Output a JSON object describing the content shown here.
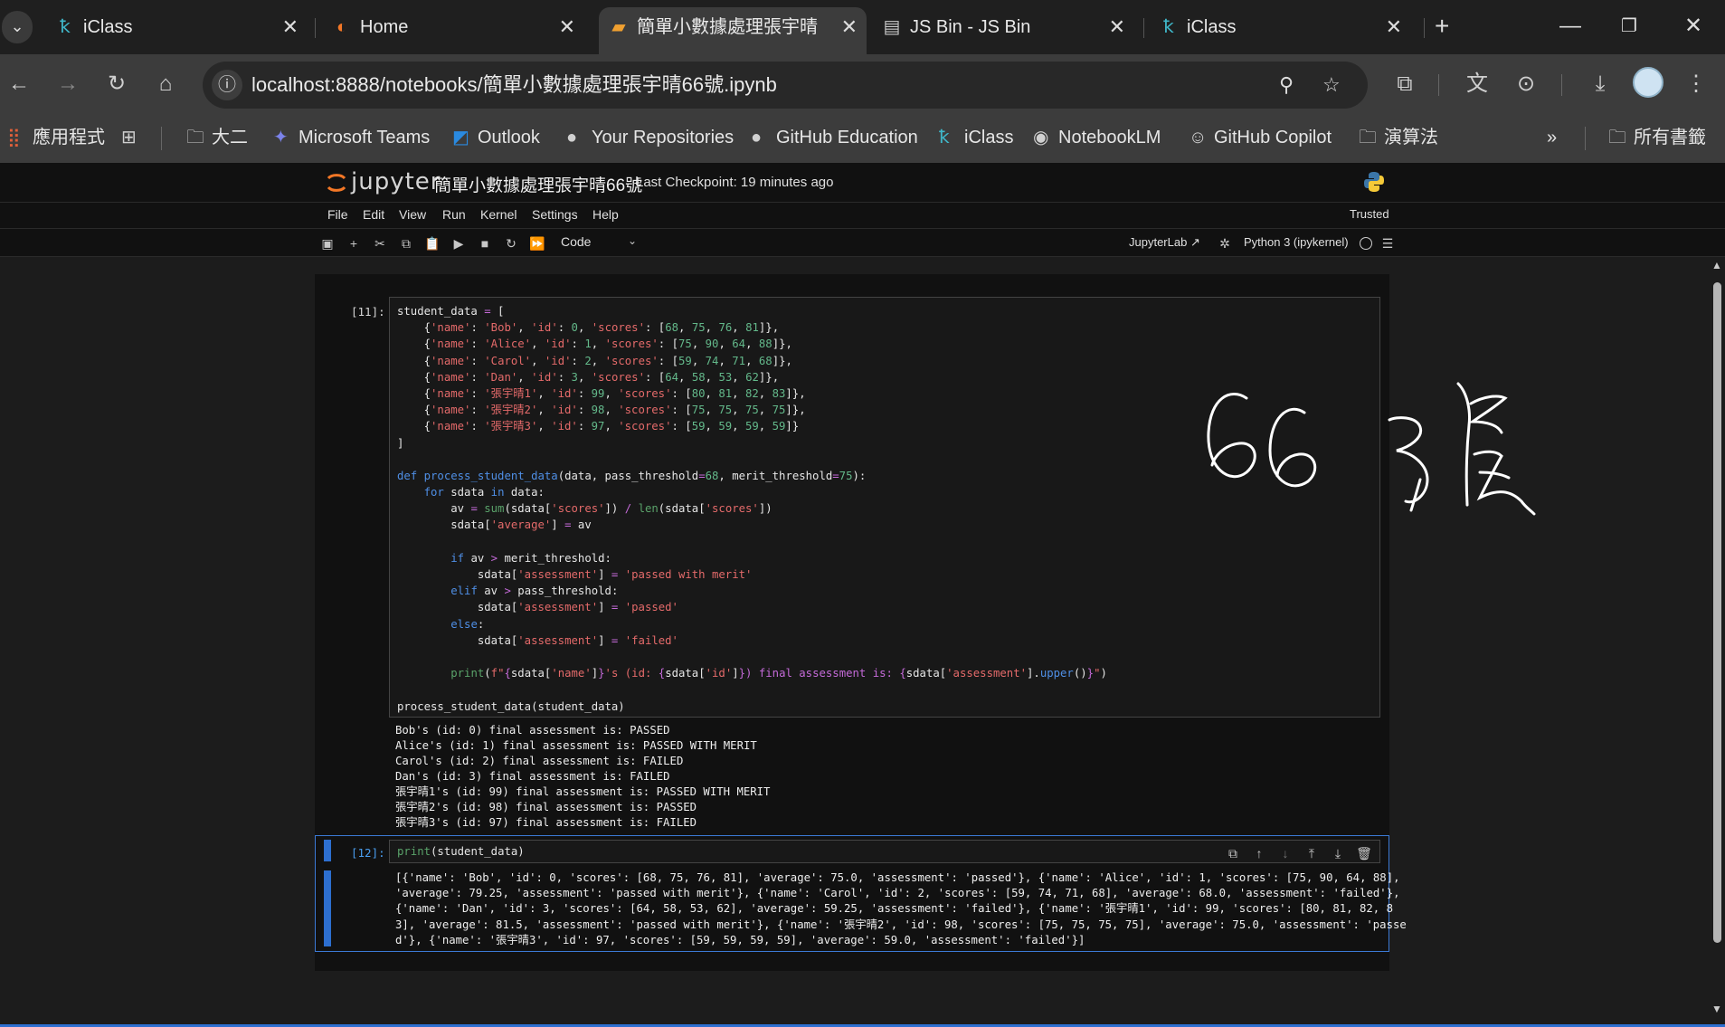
{
  "browser": {
    "tabs": [
      {
        "title": "iClass",
        "icon": "iclass-icon",
        "active": false
      },
      {
        "title": "Home",
        "icon": "jupyter-icon",
        "active": false
      },
      {
        "title": "簡單小數據處理張宇晴66",
        "icon": "notebook-icon",
        "active": true
      },
      {
        "title": "JS Bin - JS Bin",
        "icon": "jsbin-icon",
        "active": false
      },
      {
        "title": "iClass",
        "icon": "iclass-icon",
        "active": false
      }
    ],
    "close_glyph": "✕",
    "new_tab_glyph": "+",
    "url": "localhost:8888/notebooks/簡單小數據處理張宇晴66號.ipynb",
    "bookmarks": [
      {
        "label": "應用程式",
        "icon": "apps-grid-icon"
      },
      {
        "label": "",
        "icon": "grid-icon"
      },
      {
        "label": "大二",
        "icon": "folder-icon"
      },
      {
        "label": "Microsoft Teams",
        "icon": "teams-icon"
      },
      {
        "label": "Outlook",
        "icon": "outlook-icon"
      },
      {
        "label": "Your Repositories",
        "icon": "github-icon"
      },
      {
        "label": "GitHub Education",
        "icon": "github-icon"
      },
      {
        "label": "iClass",
        "icon": "iclass-icon"
      },
      {
        "label": "NotebookLM",
        "icon": "notebooklm-icon"
      },
      {
        "label": "GitHub Copilot",
        "icon": "copilot-icon"
      },
      {
        "label": "演算法",
        "icon": "folder-icon"
      },
      {
        "label": "所有書籤",
        "icon": "folder-icon"
      }
    ],
    "bookmarks_overflow": "»"
  },
  "jupyter": {
    "logo_text": "jupyter",
    "notebook_title": "簡單小數據處理張宇晴66號",
    "checkpoint": "Last Checkpoint: 19 minutes ago",
    "menu": [
      "File",
      "Edit",
      "View",
      "Run",
      "Kernel",
      "Settings",
      "Help"
    ],
    "trusted": "Trusted",
    "cell_type": "Code",
    "jupyterlab_link": "JupyterLab",
    "kernel_name": "Python 3 (ipykernel)"
  },
  "cells": [
    {
      "prompt": "[11]:",
      "code": [
        [
          [
            "student_data ",
            ""
          ],
          [
            "=",
            "op"
          ],
          [
            " [",
            ""
          ]
        ],
        [
          [
            "    {",
            ""
          ],
          [
            "'name'",
            "str"
          ],
          [
            ": ",
            ""
          ],
          [
            "'Bob'",
            "str"
          ],
          [
            ", ",
            ""
          ],
          [
            "'id'",
            "str"
          ],
          [
            ": ",
            ""
          ],
          [
            "0",
            "num"
          ],
          [
            ", ",
            ""
          ],
          [
            "'scores'",
            "str"
          ],
          [
            ": [",
            ""
          ],
          [
            "68",
            "num"
          ],
          [
            ", ",
            ""
          ],
          [
            "75",
            "num"
          ],
          [
            ", ",
            ""
          ],
          [
            "76",
            "num"
          ],
          [
            ", ",
            ""
          ],
          [
            "81",
            "num"
          ],
          [
            "]},",
            ""
          ]
        ],
        [
          [
            "    {",
            ""
          ],
          [
            "'name'",
            "str"
          ],
          [
            ": ",
            ""
          ],
          [
            "'Alice'",
            "str"
          ],
          [
            ", ",
            ""
          ],
          [
            "'id'",
            "str"
          ],
          [
            ": ",
            ""
          ],
          [
            "1",
            "num"
          ],
          [
            ", ",
            ""
          ],
          [
            "'scores'",
            "str"
          ],
          [
            ": [",
            ""
          ],
          [
            "75",
            "num"
          ],
          [
            ", ",
            ""
          ],
          [
            "90",
            "num"
          ],
          [
            ", ",
            ""
          ],
          [
            "64",
            "num"
          ],
          [
            ", ",
            ""
          ],
          [
            "88",
            "num"
          ],
          [
            "]},",
            ""
          ]
        ],
        [
          [
            "    {",
            ""
          ],
          [
            "'name'",
            "str"
          ],
          [
            ": ",
            ""
          ],
          [
            "'Carol'",
            "str"
          ],
          [
            ", ",
            ""
          ],
          [
            "'id'",
            "str"
          ],
          [
            ": ",
            ""
          ],
          [
            "2",
            "num"
          ],
          [
            ", ",
            ""
          ],
          [
            "'scores'",
            "str"
          ],
          [
            ": [",
            ""
          ],
          [
            "59",
            "num"
          ],
          [
            ", ",
            ""
          ],
          [
            "74",
            "num"
          ],
          [
            ", ",
            ""
          ],
          [
            "71",
            "num"
          ],
          [
            ", ",
            ""
          ],
          [
            "68",
            "num"
          ],
          [
            "]},",
            ""
          ]
        ],
        [
          [
            "    {",
            ""
          ],
          [
            "'name'",
            "str"
          ],
          [
            ": ",
            ""
          ],
          [
            "'Dan'",
            "str"
          ],
          [
            ", ",
            ""
          ],
          [
            "'id'",
            "str"
          ],
          [
            ": ",
            ""
          ],
          [
            "3",
            "num"
          ],
          [
            ", ",
            ""
          ],
          [
            "'scores'",
            "str"
          ],
          [
            ": [",
            ""
          ],
          [
            "64",
            "num"
          ],
          [
            ", ",
            ""
          ],
          [
            "58",
            "num"
          ],
          [
            ", ",
            ""
          ],
          [
            "53",
            "num"
          ],
          [
            ", ",
            ""
          ],
          [
            "62",
            "num"
          ],
          [
            "]},",
            ""
          ]
        ],
        [
          [
            "    {",
            ""
          ],
          [
            "'name'",
            "str"
          ],
          [
            ": ",
            ""
          ],
          [
            "'張宇晴1'",
            "str"
          ],
          [
            ", ",
            ""
          ],
          [
            "'id'",
            "str"
          ],
          [
            ": ",
            ""
          ],
          [
            "99",
            "num"
          ],
          [
            ", ",
            ""
          ],
          [
            "'scores'",
            "str"
          ],
          [
            ": [",
            ""
          ],
          [
            "80",
            "num"
          ],
          [
            ", ",
            ""
          ],
          [
            "81",
            "num"
          ],
          [
            ", ",
            ""
          ],
          [
            "82",
            "num"
          ],
          [
            ", ",
            ""
          ],
          [
            "83",
            "num"
          ],
          [
            "]},",
            ""
          ]
        ],
        [
          [
            "    {",
            ""
          ],
          [
            "'name'",
            "str"
          ],
          [
            ": ",
            ""
          ],
          [
            "'張宇晴2'",
            "str"
          ],
          [
            ", ",
            ""
          ],
          [
            "'id'",
            "str"
          ],
          [
            ": ",
            ""
          ],
          [
            "98",
            "num"
          ],
          [
            ", ",
            ""
          ],
          [
            "'scores'",
            "str"
          ],
          [
            ": [",
            ""
          ],
          [
            "75",
            "num"
          ],
          [
            ", ",
            ""
          ],
          [
            "75",
            "num"
          ],
          [
            ", ",
            ""
          ],
          [
            "75",
            "num"
          ],
          [
            ", ",
            ""
          ],
          [
            "75",
            "num"
          ],
          [
            "]},",
            ""
          ]
        ],
        [
          [
            "    {",
            ""
          ],
          [
            "'name'",
            "str"
          ],
          [
            ": ",
            ""
          ],
          [
            "'張宇晴3'",
            "str"
          ],
          [
            ", ",
            ""
          ],
          [
            "'id'",
            "str"
          ],
          [
            ": ",
            ""
          ],
          [
            "97",
            "num"
          ],
          [
            ", ",
            ""
          ],
          [
            "'scores'",
            "str"
          ],
          [
            ": [",
            ""
          ],
          [
            "59",
            "num"
          ],
          [
            ", ",
            ""
          ],
          [
            "59",
            "num"
          ],
          [
            ", ",
            ""
          ],
          [
            "59",
            "num"
          ],
          [
            ", ",
            ""
          ],
          [
            "59",
            "num"
          ],
          [
            "]}",
            ""
          ]
        ],
        [
          [
            "]",
            ""
          ]
        ],
        [
          [
            "",
            ""
          ]
        ],
        [
          [
            "def",
            "kw"
          ],
          [
            " ",
            ""
          ],
          [
            "process_student_data",
            "fn"
          ],
          [
            "(data, pass_threshold",
            ""
          ],
          [
            "=",
            "op"
          ],
          [
            "68",
            "num"
          ],
          [
            ", merit_threshold",
            ""
          ],
          [
            "=",
            "op"
          ],
          [
            "75",
            "num"
          ],
          [
            "):",
            ""
          ]
        ],
        [
          [
            "    ",
            ""
          ],
          [
            "for",
            "kw"
          ],
          [
            " sdata ",
            ""
          ],
          [
            "in",
            "kw"
          ],
          [
            " data:",
            ""
          ]
        ],
        [
          [
            "        av ",
            ""
          ],
          [
            "=",
            "op"
          ],
          [
            " ",
            ""
          ],
          [
            "sum",
            "bi"
          ],
          [
            "(sdata[",
            ""
          ],
          [
            "'scores'",
            "str"
          ],
          [
            "]) ",
            ""
          ],
          [
            "/",
            "op"
          ],
          [
            " ",
            ""
          ],
          [
            "len",
            "bi"
          ],
          [
            "(sdata[",
            ""
          ],
          [
            "'scores'",
            "str"
          ],
          [
            "])",
            ""
          ]
        ],
        [
          [
            "        sdata[",
            ""
          ],
          [
            "'average'",
            "str"
          ],
          [
            "] ",
            ""
          ],
          [
            "=",
            "op"
          ],
          [
            " av",
            ""
          ]
        ],
        [
          [
            "",
            ""
          ]
        ],
        [
          [
            "        ",
            ""
          ],
          [
            "if",
            "kw"
          ],
          [
            " av ",
            ""
          ],
          [
            ">",
            "op"
          ],
          [
            " merit_threshold:",
            ""
          ]
        ],
        [
          [
            "            sdata[",
            ""
          ],
          [
            "'assessment'",
            "str"
          ],
          [
            "] ",
            ""
          ],
          [
            "=",
            "op"
          ],
          [
            " ",
            ""
          ],
          [
            "'passed with merit'",
            "str"
          ]
        ],
        [
          [
            "        ",
            ""
          ],
          [
            "elif",
            "kw"
          ],
          [
            " av ",
            ""
          ],
          [
            ">",
            "op"
          ],
          [
            " pass_threshold:",
            ""
          ]
        ],
        [
          [
            "            sdata[",
            ""
          ],
          [
            "'assessment'",
            "str"
          ],
          [
            "] ",
            ""
          ],
          [
            "=",
            "op"
          ],
          [
            " ",
            ""
          ],
          [
            "'passed'",
            "str"
          ]
        ],
        [
          [
            "        ",
            ""
          ],
          [
            "else",
            "kw"
          ],
          [
            ":",
            ""
          ]
        ],
        [
          [
            "            sdata[",
            ""
          ],
          [
            "'assessment'",
            "str"
          ],
          [
            "] ",
            ""
          ],
          [
            "=",
            "op"
          ],
          [
            " ",
            ""
          ],
          [
            "'failed'",
            "str"
          ]
        ],
        [
          [
            "",
            ""
          ]
        ],
        [
          [
            "        ",
            ""
          ],
          [
            "print",
            "bi"
          ],
          [
            "(",
            ""
          ],
          [
            "f\"",
            "str"
          ],
          [
            "{",
            "op"
          ],
          [
            "sdata[",
            ""
          ],
          [
            "'name'",
            "str"
          ],
          [
            "]",
            ""
          ],
          [
            "}",
            "op"
          ],
          [
            "'s (id: ",
            "str"
          ],
          [
            "{",
            "op"
          ],
          [
            "sdata[",
            ""
          ],
          [
            "'id'",
            "str"
          ],
          [
            "]",
            ""
          ],
          [
            "}",
            "op"
          ],
          [
            ") final assessment is: ",
            "pr"
          ],
          [
            "{",
            "op"
          ],
          [
            "sdata[",
            ""
          ],
          [
            "'assessment'",
            "str"
          ],
          [
            "].",
            ""
          ],
          [
            "upper",
            "fn"
          ],
          [
            "()",
            ""
          ],
          [
            "}",
            "op"
          ],
          [
            "\"",
            "str"
          ],
          [
            ")",
            ""
          ]
        ],
        [
          [
            "",
            ""
          ]
        ],
        [
          [
            "process_student_data(student_data)",
            ""
          ]
        ]
      ],
      "output": [
        "Bob's (id: 0) final assessment is: PASSED",
        "Alice's (id: 1) final assessment is: PASSED WITH MERIT",
        "Carol's (id: 2) final assessment is: FAILED",
        "Dan's (id: 3) final assessment is: FAILED",
        "張宇晴1's (id: 99) final assessment is: PASSED WITH MERIT",
        "張宇晴2's (id: 98) final assessment is: PASSED",
        "張宇晴3's (id: 97) final assessment is: FAILED"
      ]
    },
    {
      "prompt": "[12]:",
      "code": [
        [
          [
            "print",
            "bi"
          ],
          [
            "(student_data)",
            ""
          ]
        ]
      ],
      "output": [
        "[{'name': 'Bob', 'id': 0, 'scores': [68, 75, 76, 81], 'average': 75.0, 'assessment': 'passed'}, {'name': 'Alice', 'id': 1, 'scores': [75, 90, 64, 88],",
        "'average': 79.25, 'assessment': 'passed with merit'}, {'name': 'Carol', 'id': 2, 'scores': [59, 74, 71, 68], 'average': 68.0, 'assessment': 'failed'},",
        "{'name': 'Dan', 'id': 3, 'scores': [64, 58, 53, 62], 'average': 59.25, 'assessment': 'failed'}, {'name': '張宇晴1', 'id': 99, 'scores': [80, 81, 82, 8",
        "3], 'average': 81.5, 'assessment': 'passed with merit'}, {'name': '張宇晴2', 'id': 98, 'scores': [75, 75, 75, 75], 'average': 75.0, 'assessment': 'passe",
        "d'}, {'name': '張宇晴3', 'id': 97, 'scores': [59, 59, 59, 59], 'average': 59.0, 'assessment': 'failed'}]"
      ]
    }
  ]
}
